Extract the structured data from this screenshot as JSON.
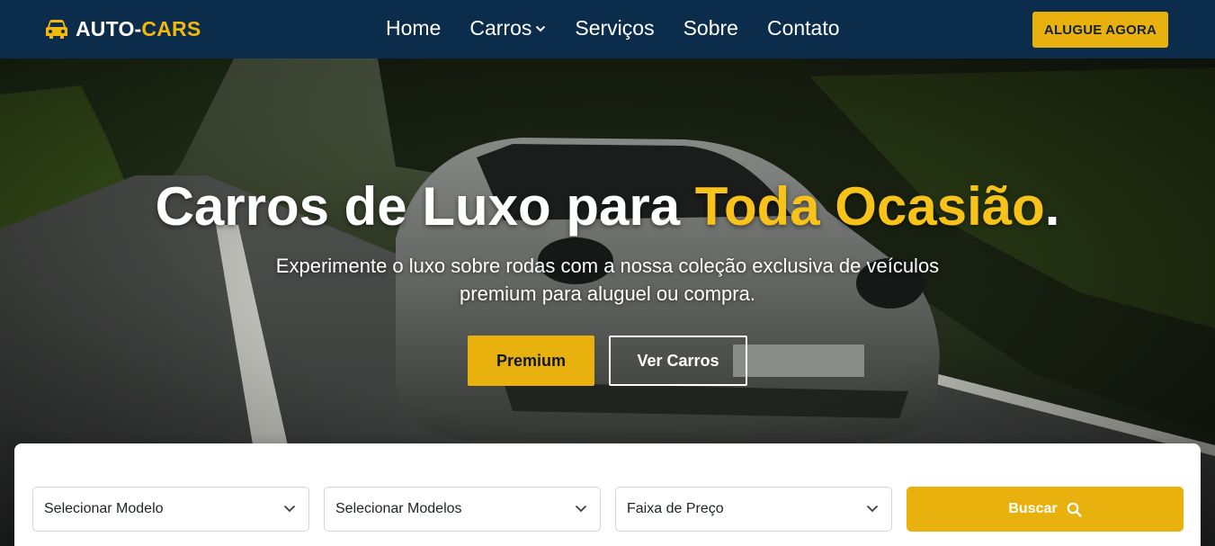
{
  "nav": {
    "brand_part1": "AUTO-",
    "brand_part2": "CARS",
    "brand_icon": "car-icon",
    "links": [
      {
        "label": "Home"
      },
      {
        "label": "Carros",
        "has_dropdown": true
      },
      {
        "label": "Serviços"
      },
      {
        "label": "Sobre"
      },
      {
        "label": "Contato"
      }
    ],
    "cta_label": "ALUGUE AGORA"
  },
  "hero": {
    "title_main": "Carros de Luxo para ",
    "title_accent": "Toda Ocasião",
    "title_end": ".",
    "subtitle": "Experimente o luxo sobre rodas com a nossa coleção exclusiva de veículos premium para aluguel ou compra.",
    "primary_button": "Premium",
    "secondary_button": "Ver Carros"
  },
  "search": {
    "select_model": "Selecionar Modelo",
    "select_models": "Selecionar Modelos",
    "price_range": "Faixa de Preço",
    "search_button": "Buscar",
    "search_icon": "search-icon"
  },
  "colors": {
    "navbar_bg": "#0b2c4a",
    "accent": "#e9b10d",
    "title_accent": "#f7c21a",
    "white": "#ffffff"
  }
}
